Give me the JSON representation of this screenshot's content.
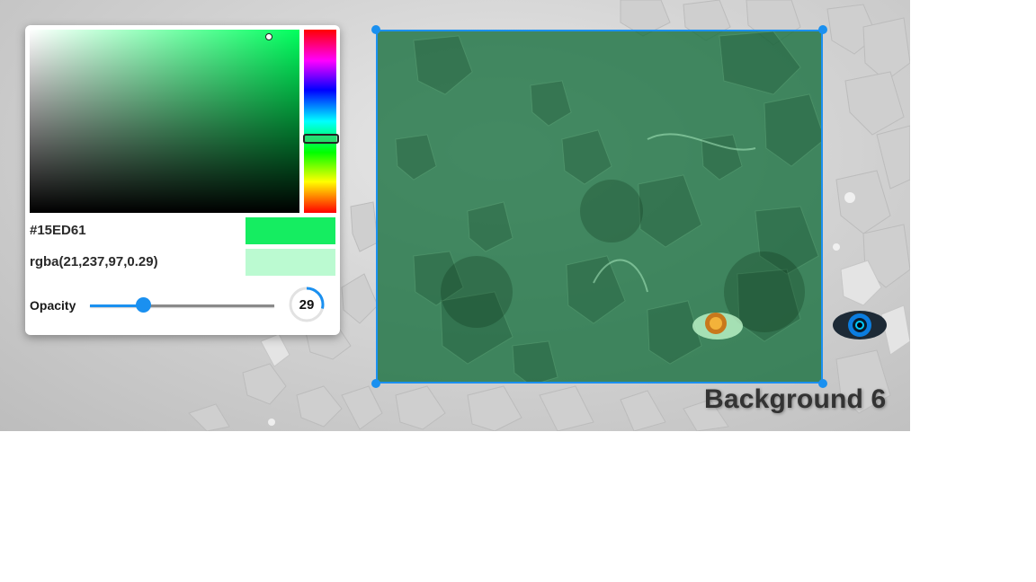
{
  "picker": {
    "hex_value": "#15ED61",
    "rgba_value": "rgba(21,237,97,0.29)",
    "opacity_label": "Opacity",
    "opacity_value": "29",
    "opacity_fraction": 0.29,
    "solid_color": "#15ED61",
    "transparent_color": "rgba(21,237,97,0.29)",
    "hue_color": "#00ff5e"
  },
  "background": {
    "title": "Background 6"
  },
  "colors": {
    "accent": "#1a90f0",
    "overlay_tint": "#156e3c"
  }
}
